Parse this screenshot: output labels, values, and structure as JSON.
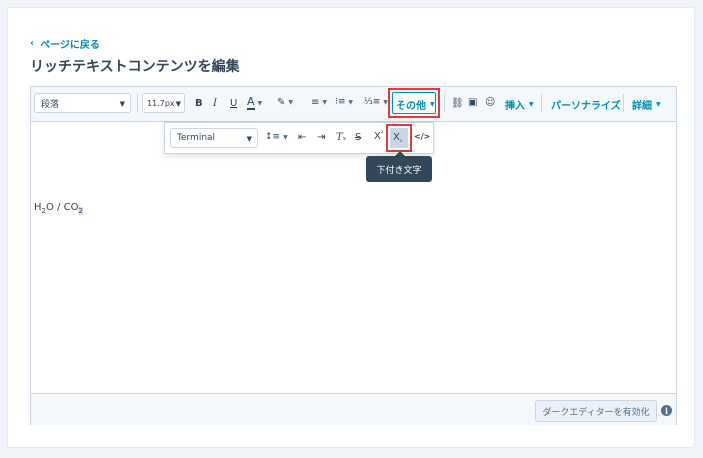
{
  "back_link": {
    "arrow": "‹",
    "label": "ページに戻る"
  },
  "page_title": "リッチテキストコンテンツを編集",
  "toolbar": {
    "paragraph_select": "段落",
    "font_size_select": "11.7px",
    "bold": "B",
    "italic": "I",
    "underline": "U",
    "text_color": "A",
    "other_label": "その他",
    "insert_label": "挿入",
    "personalize_label": "パーソナライズ",
    "details_label": "詳細"
  },
  "popup": {
    "font_select": "Terminal",
    "superscript": "X",
    "subscript": "X",
    "code": "</>"
  },
  "tooltip": "下付き文字",
  "content": {
    "h": "H",
    "two1": "2",
    "o_sep": "O / CO",
    "two2": "2"
  },
  "footer": {
    "dark_editor_button": "ダークエディターを有効化",
    "info": "i"
  },
  "colors": {
    "accent": "#0091ae",
    "highlight": "#e23a3a",
    "text": "#33475b"
  }
}
